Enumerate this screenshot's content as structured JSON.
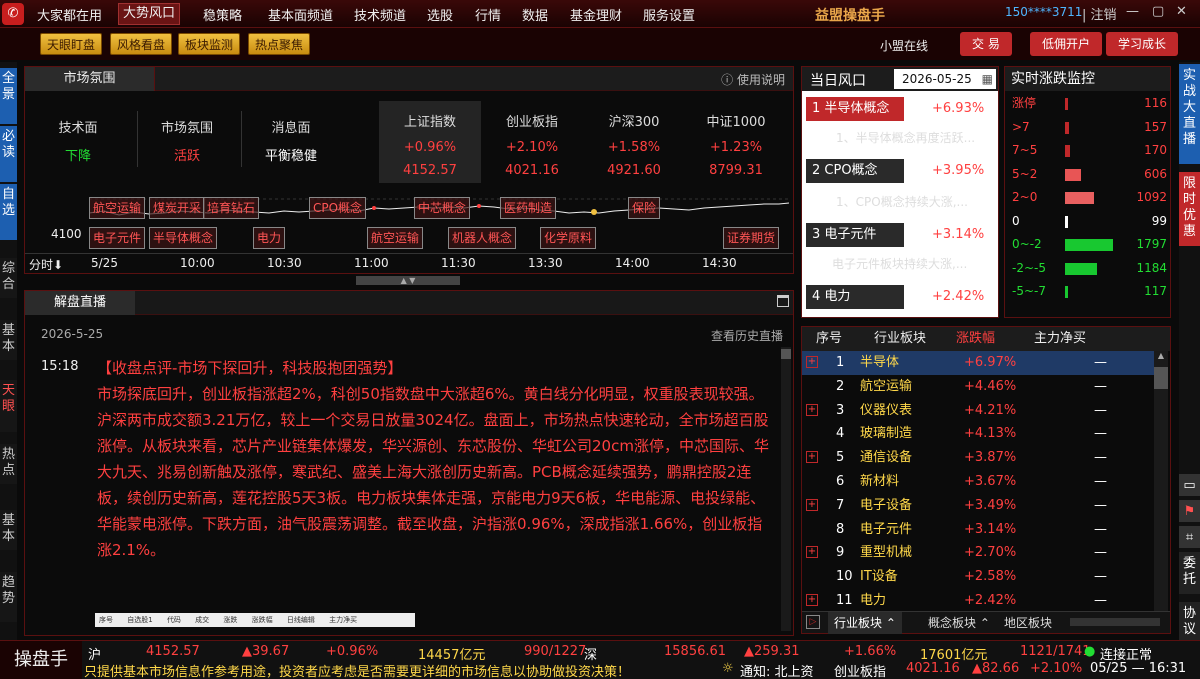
{
  "menubar": {
    "items": [
      "大家都在用",
      "大势风口",
      "稳策略",
      "基本面频道",
      "技术频道",
      "选股",
      "行情",
      "数据",
      "基金理财",
      "服务设置"
    ],
    "brand": "益盟操盘手",
    "user": "150****3711",
    "logout": "注销"
  },
  "toolbar": {
    "buttons": [
      "天眼盯盘",
      "风格看盘",
      "板块监测",
      "热点聚焦"
    ],
    "status": "小盟在线",
    "trade": "交 易",
    "open_account": "低佣开户",
    "learn": "学习成长"
  },
  "leftbar": [
    "全景",
    "必读",
    "自选",
    "综合",
    "基本",
    "天眼",
    "热点",
    "基本",
    "趋势"
  ],
  "rightbar": [
    "实战大直播",
    "限时优惠",
    "委托",
    "协议"
  ],
  "market": {
    "title": "市场氛围",
    "help": "使用说明",
    "labels": [
      "技术面",
      "市场氛围",
      "消息面"
    ],
    "values": [
      "下降",
      "活跃",
      "平衡稳健"
    ],
    "indices": [
      {
        "name": "上证指数",
        "pct": "+0.96%",
        "val": "4152.57"
      },
      {
        "name": "创业板指",
        "pct": "+2.10%",
        "val": "4021.16"
      },
      {
        "name": "沪深300",
        "pct": "+1.58%",
        "val": "4921.60"
      },
      {
        "name": "中证1000",
        "pct": "+1.23%",
        "val": "8799.31"
      }
    ],
    "level": "4100",
    "time_label": "分时",
    "times": [
      "5/25",
      "10:00",
      "10:30",
      "11:00",
      "11:30",
      "13:30",
      "14:00",
      "14:30"
    ],
    "tags_top": [
      "航空运输",
      "煤炭开采",
      "培育钻石",
      "CPO概念",
      "中芯概念",
      "医药制造",
      "保险"
    ],
    "tags_bottom": [
      "电子元件",
      "半导体概念",
      "电力",
      "航空运输",
      "机器人概念",
      "化学原料",
      "证券期货"
    ]
  },
  "live": {
    "title": "解盘直播",
    "date": "2026-5-25",
    "history": "查看历史直播",
    "time": "15:18",
    "headline": "【收盘点评-市场下探回升，科技股抱团强势】",
    "body": "市场探底回升，创业板指涨超2%，科创50指数盘中大涨超6%。黄白线分化明显，权重股表现较强。沪深两市成交额3.21万亿，较上一个交易日放量3024亿。盘面上，市场热点快速轮动，全市场超百股涨停。从板块来看，芯片产业链集体爆发，华兴源创、东芯股份、华虹公司20cm涨停，中芯国际、华大九天、兆易创新触及涨停，寒武纪、盛美上海大涨创历史新高。PCB概念延续强势，鹏鼎控股2连板，续创历史新高，莲花控股5天3板。电力板块集体走强，京能电力9天6板，华电能源、电投绿能、华能蒙电涨停。下跌方面，油气股震荡调整。截至收盘，沪指涨0.96%，深成指涨1.66%，创业板指涨2.1%。",
    "mini_headers": [
      "序号",
      "自选股1",
      "代码",
      "成交",
      "涨跌",
      "涨跌幅",
      "日线编辑",
      "主力净买"
    ]
  },
  "risk": {
    "title": "当日风口",
    "date": "2026-05-25",
    "items": [
      {
        "name": "1 半导体概念",
        "pct": "+6.93%",
        "desc": "1、半导体概念再度活跃..."
      },
      {
        "name": "2 CPO概念",
        "pct": "+3.95%",
        "desc": "1、CPO概念持续大涨,..."
      },
      {
        "name": "3 电子元件",
        "pct": "+3.14%",
        "desc": "电子元件板块持续大涨,..."
      },
      {
        "name": "4 电力",
        "pct": "+2.42%",
        "desc": ""
      }
    ]
  },
  "monitor": {
    "title": "实时涨跌监控",
    "rows": [
      {
        "label": "涨停",
        "val": "116"
      },
      {
        "label": ">7",
        "val": "157"
      },
      {
        "label": "7~5",
        "val": "170"
      },
      {
        "label": "5~2",
        "val": "606"
      },
      {
        "label": "2~0",
        "val": "1092"
      },
      {
        "label": "0",
        "val": "99"
      },
      {
        "label": "0~-2",
        "val": "1797"
      },
      {
        "label": "-2~-5",
        "val": "1184"
      },
      {
        "label": "-5~-7",
        "val": "117"
      }
    ]
  },
  "sectors": {
    "headers": [
      "序号",
      "行业板块",
      "涨跌幅",
      "主力净买"
    ],
    "rows": [
      {
        "n": "1",
        "name": "半导体",
        "pct": "+6.97%",
        "net": "—"
      },
      {
        "n": "2",
        "name": "航空运输",
        "pct": "+4.46%",
        "net": "—"
      },
      {
        "n": "3",
        "name": "仪器仪表",
        "pct": "+4.21%",
        "net": "—"
      },
      {
        "n": "4",
        "name": "玻璃制造",
        "pct": "+4.13%",
        "net": "—"
      },
      {
        "n": "5",
        "name": "通信设备",
        "pct": "+3.87%",
        "net": "—"
      },
      {
        "n": "6",
        "name": "新材料",
        "pct": "+3.67%",
        "net": "—"
      },
      {
        "n": "7",
        "name": "电子设备",
        "pct": "+3.49%",
        "net": "—"
      },
      {
        "n": "8",
        "name": "电子元件",
        "pct": "+3.14%",
        "net": "—"
      },
      {
        "n": "9",
        "name": "重型机械",
        "pct": "+2.70%",
        "net": "—"
      },
      {
        "n": "10",
        "name": "IT设备",
        "pct": "+2.58%",
        "net": "—"
      },
      {
        "n": "11",
        "name": "电力",
        "pct": "+2.42%",
        "net": "—"
      }
    ],
    "tabs": [
      "行业板块",
      "概念板块",
      "地区板块"
    ]
  },
  "bottom": {
    "logo": "操盘手",
    "sh": {
      "name": "沪",
      "val": "4152.57",
      "chg": "▲39.67",
      "pct": "+0.96%",
      "amt": "14457亿元",
      "updown": "990/1227"
    },
    "sz": {
      "name": "深",
      "val": "15856.61",
      "chg": "▲259.31",
      "pct": "+1.66%",
      "amt": "17601亿元",
      "updown": "1121/1741"
    },
    "notice": "只提供基本市场信息作参考用途，投资者应考虑是否需要更详细的市场信息以协助做投资决策！",
    "notice2": "通知: 北上资",
    "cy": {
      "name": "创业板指",
      "val": "4021.16",
      "chg": "▲82.66",
      "pct": "+2.10%"
    },
    "conn": "连接正常",
    "datetime": "05/25 — 16:31"
  },
  "colors": {
    "accent": "#c0282a",
    "up": "#ff4040",
    "down": "#22dd33"
  }
}
